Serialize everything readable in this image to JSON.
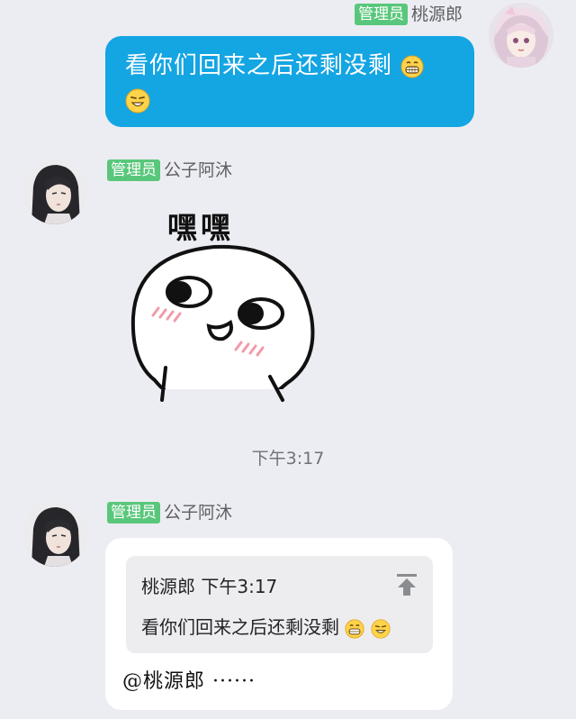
{
  "messages": {
    "m1": {
      "badge": "管理员",
      "sender": "桃源郎",
      "text": "看你们回来之后还剩没剩"
    },
    "m2": {
      "badge": "管理员",
      "sender": "公子阿沐",
      "sticker_caption": "嘿嘿"
    },
    "timestamp": "下午3:17",
    "m3": {
      "badge": "管理员",
      "sender": "公子阿沐",
      "quote": {
        "author": "桃源郎",
        "time": "下午3:17",
        "text": "看你们回来之后还剩没剩"
      },
      "reply": "@桃源郎 ······"
    }
  },
  "icons": {
    "emoji1": "grinning-emoji-icon",
    "emoji2": "smiling-emoji-icon",
    "jump": "jump-to-top-arrow-icon"
  },
  "colors": {
    "background": "#ecedf2",
    "self_bubble": "#14a5e3",
    "admin_badge": "#59c77b",
    "other_bubble": "#ffffff",
    "quote_box": "#ededf0"
  }
}
